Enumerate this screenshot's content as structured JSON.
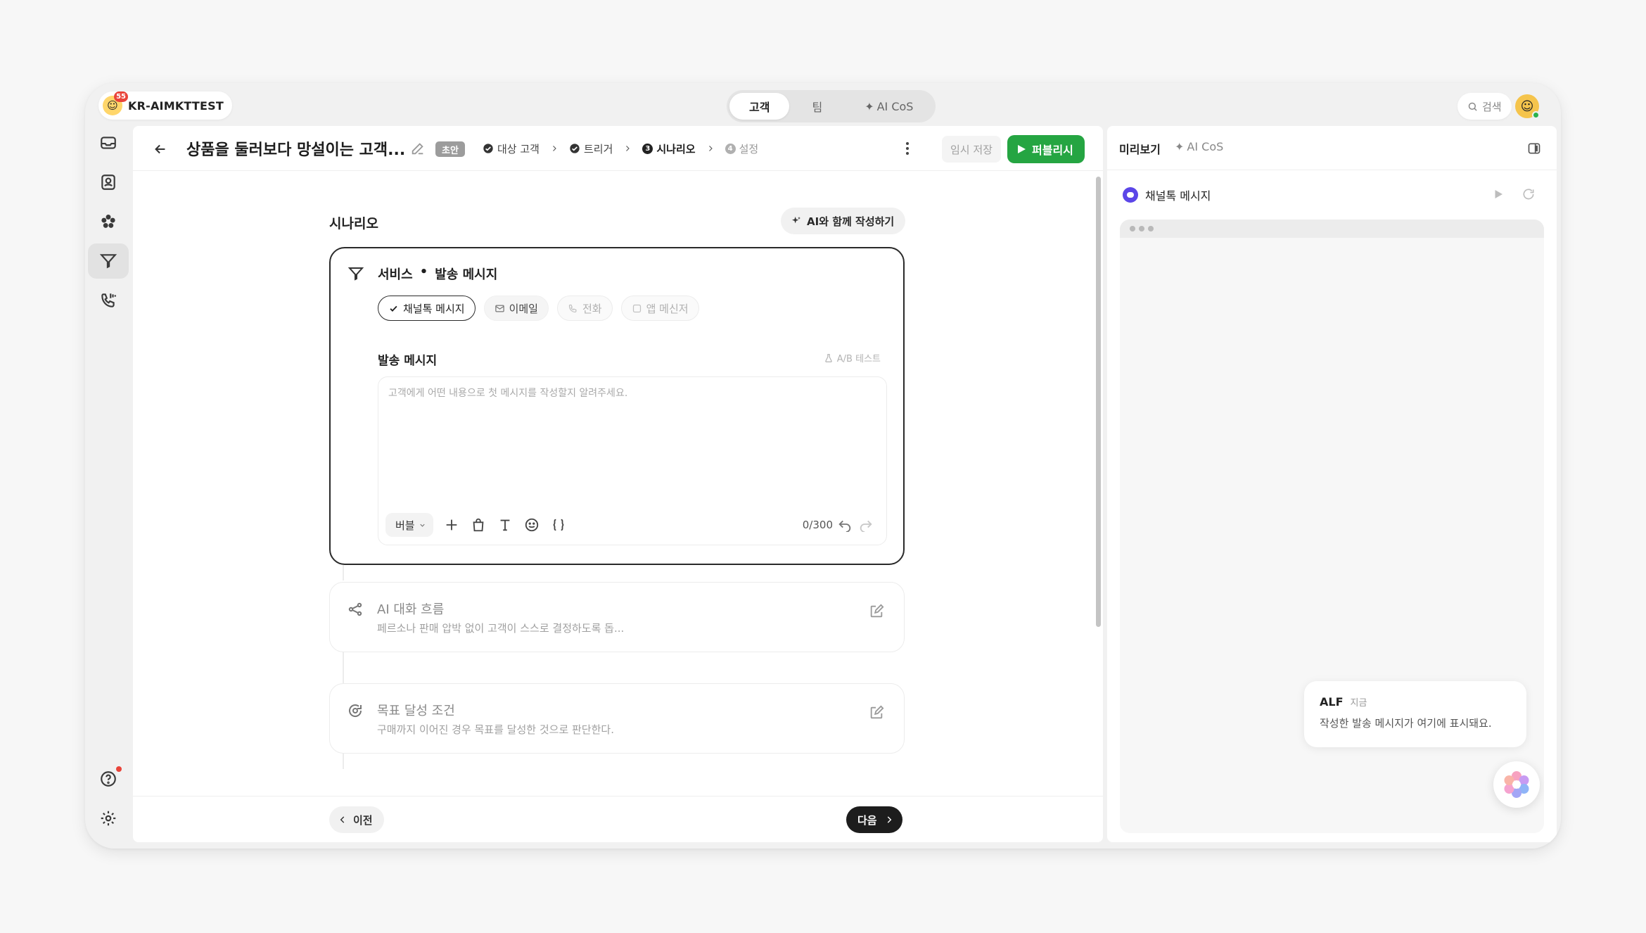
{
  "workspace": {
    "name": "KR-AIMKTTEST",
    "badge": "55"
  },
  "top_tabs": [
    {
      "label": "고객",
      "active": true
    },
    {
      "label": "팀",
      "active": false
    },
    {
      "label": "AI CoS",
      "active": false
    }
  ],
  "search": {
    "label": "검색"
  },
  "header": {
    "title": "상품을 둘러보다 망설이는 고객...",
    "status": "초안",
    "steps": [
      {
        "num": "1",
        "label": "대상 고객",
        "state": "done"
      },
      {
        "num": "2",
        "label": "트리거",
        "state": "done"
      },
      {
        "num": "3",
        "label": "시나리오",
        "state": "current"
      },
      {
        "num": "4",
        "label": "설정",
        "state": "pending"
      }
    ],
    "save_draft": "임시 저장",
    "publish": "퍼블리시"
  },
  "scenario": {
    "section_title": "시나리오",
    "ai_write_label": "AI와 함께 작성하기",
    "service_label": "서비스",
    "service_dot": "•",
    "service_name": "발송 메시지",
    "channels": [
      {
        "label": "채널톡 메시지",
        "state": "selected",
        "icon": "check-icon"
      },
      {
        "label": "이메일",
        "state": "available",
        "icon": "mail-icon"
      },
      {
        "label": "전화",
        "state": "disabled",
        "icon": "phone-icon"
      },
      {
        "label": "앱 메신저",
        "state": "disabled",
        "icon": "app-icon"
      }
    ],
    "message_label": "발송 메시지",
    "ab_test": "A/B 테스트",
    "composer_placeholder": "고객에게 어떤 내용으로 첫 메시지를 작성할지 알려주세요.",
    "composer_value": "",
    "bubble_select": "버블",
    "counter": "0/300"
  },
  "ai_flow": {
    "title": "AI 대화 흐름",
    "desc": "페르소나 판매 압박 없이 고객이 스스로 결정하도록 돕..."
  },
  "goal": {
    "title": "목표 달성 조건",
    "desc": "구매까지 이어진 경우 목표를 달성한 것으로 판단한다."
  },
  "footer": {
    "prev": "이전",
    "next": "다음"
  },
  "preview": {
    "tab_active": "미리보기",
    "tab_inactive": "AI CoS",
    "channel_name": "채널톡 메시지",
    "bubble_name": "ALF",
    "bubble_time": "지금",
    "bubble_text": "작성한 발송 메시지가 여기에 표시돼요."
  },
  "colors": {
    "publish": "#25a542",
    "badge": "#e9443a",
    "channel_icon": "#5b46e8",
    "next_button": "#1d1d1d"
  }
}
